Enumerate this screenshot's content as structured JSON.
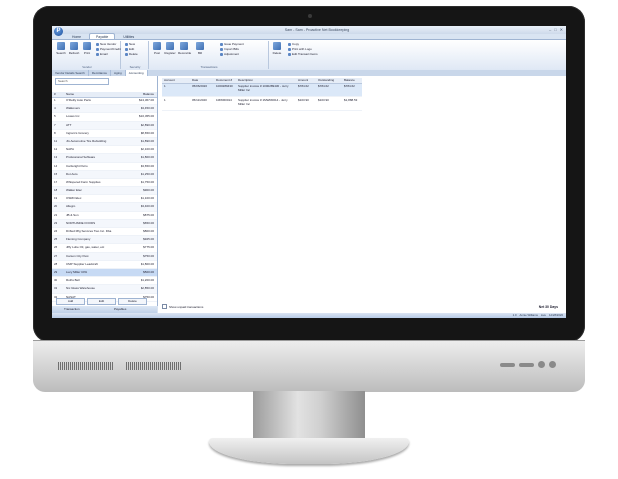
{
  "window": {
    "title": "Sam - Sam - Proactive Net Bookkeeping",
    "app_initial": "P"
  },
  "ribbon_tabs": [
    "Home",
    "Payable",
    "Utilities"
  ],
  "ribbon": {
    "groups": [
      {
        "label": "Vendor",
        "buttons": [
          "Search",
          "Refresh",
          "Print"
        ],
        "small": [
          "New Vendor",
          "Payment/Credit",
          "Email"
        ]
      },
      {
        "label": "Security",
        "small": [
          "New",
          "Edit",
          "Delete"
        ]
      },
      {
        "label": "Transactions",
        "buttons": [
          "Post",
          "Register",
          "Reconcile",
          "Bill"
        ],
        "small": [
          "Issue Payment",
          "Import Bills",
          "Adjustment"
        ]
      },
      {
        "label": "",
        "buttons": [
          "Delete",
          "Print"
        ],
        "small": [
          "Copy",
          "Print with Logo",
          "Edit Transact Items"
        ]
      }
    ]
  },
  "subtabs": [
    "Vendor Details Search",
    "Remittance",
    "Aging",
    "Accounting"
  ],
  "left": {
    "search_label": "Search",
    "columns": [
      "#",
      "Name",
      "Balance"
    ],
    "vendors": [
      {
        "id": "1",
        "name": "O'Reilly Auto Parts",
        "balance": "$24,367.00"
      },
      {
        "id": "4",
        "name": "Walkovers",
        "balance": "$3,450.00"
      },
      {
        "id": "5",
        "name": "Lowes Inc",
        "balance": "$10,455.00"
      },
      {
        "id": "7",
        "name": "ATT",
        "balance": "$2,890.00"
      },
      {
        "id": "8",
        "name": "Ingram's Grocery",
        "balance": "$8,650.00"
      },
      {
        "id": "11",
        "name": "JG Automotive Tire Rebuilding",
        "balance": "$1,890.00"
      },
      {
        "id": "12",
        "name": "NAPA",
        "balance": "$2,100.00"
      },
      {
        "id": "13",
        "name": "Professional Software",
        "balance": "$1,800.00"
      },
      {
        "id": "14",
        "name": "Cartwright Petro",
        "balance": "$3,650.00"
      },
      {
        "id": "15",
        "name": "Dot Auto",
        "balance": "$1,250.00"
      },
      {
        "id": "17",
        "name": "Whispered Farm Supplies",
        "balance": "$1,750.00"
      },
      {
        "id": "18",
        "name": "Walker Elec",
        "balance": "$900.00"
      },
      {
        "id": "19",
        "name": "OSRD Elec",
        "balance": "$1,100.00"
      },
      {
        "id": "20",
        "name": "Allegro",
        "balance": "$3,400.00"
      },
      {
        "id": "21",
        "name": "JB & Son",
        "balance": "$875.00"
      },
      {
        "id": "23",
        "name": "NORTHSIDE FOODS",
        "balance": "$650.00"
      },
      {
        "id": "24",
        "name": "Drifted Mfg Services Two Inc. Dba",
        "balance": "$800.00"
      },
      {
        "id": "25",
        "name": "Fleming Company",
        "balance": "$925.00"
      },
      {
        "id": "26",
        "name": "Jiffy Lube Oil, gas, water, etc",
        "balance": "$775.00"
      },
      {
        "id": "27",
        "name": "Carson City Pest",
        "balance": "$750.00"
      },
      {
        "id": "28",
        "name": "CMP Supplier Leadcraft",
        "balance": "$1,800.00"
      },
      {
        "id": "29",
        "name": "Lucy Miller CPA",
        "balance": "$500.00"
      },
      {
        "id": "30",
        "name": "Ruths Bell",
        "balance": "$1,200.00"
      },
      {
        "id": "31",
        "name": "Nix Glass Warehouse",
        "balance": "$2,850.00"
      },
      {
        "id": "32",
        "name": "NASAT",
        "balance": "$750.00"
      }
    ],
    "buttons": [
      "Add",
      "Edit",
      "Delete"
    ],
    "nav": [
      "Transaction",
      "Payables"
    ]
  },
  "main": {
    "columns": [
      "Account",
      "Date",
      "Document #",
      "Description",
      "Amount",
      "Outstanding",
      "Balance"
    ],
    "rows": [
      {
        "account": "1",
        "date": "05/06/2020",
        "doc": "1000289430",
        "desc": "Supplier invoice # 1000289430 - Jerry Miller Inc",
        "amount": "$784.62",
        "outstanding": "$784.62",
        "balance": "$784.62"
      },
      {
        "account": "1",
        "date": "05/11/2020",
        "doc": "1MWR0014",
        "desc": "Supplier invoice # 1MWR0014 - Jerry Miller Inc",
        "amount": "$103.90",
        "outstanding": "$103.90",
        "balance": "$1,888.53"
      }
    ],
    "show_unpaid": "Show unpaid transactions",
    "net_label": "Net 30 Days"
  },
  "status": [
    "1.0",
    "Annie Williams",
    "Live",
    "12/28/2020"
  ]
}
